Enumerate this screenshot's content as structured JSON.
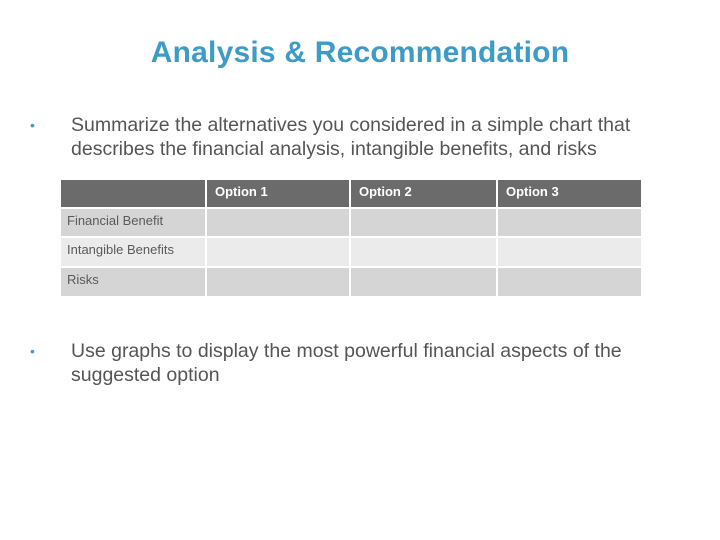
{
  "title": "Analysis & Recommendation",
  "bullets": [
    {
      "icon": "bullet-dot",
      "symbol": "•",
      "text": "Summarize the alternatives you considered in a simple chart that describes the financial analysis, intangible benefits, and risks"
    },
    {
      "icon": "bullet-dot",
      "symbol": "•",
      "text": "Use graphs to display the most powerful financial aspects of the suggested option"
    }
  ],
  "table": {
    "columns": [
      "",
      "Option 1",
      "Option 2",
      "Option 3"
    ],
    "rows": [
      {
        "label": "Financial Benefit",
        "cells": [
          "",
          "",
          ""
        ]
      },
      {
        "label": "Intangible Benefits",
        "cells": [
          "",
          "",
          ""
        ]
      },
      {
        "label": "Risks",
        "cells": [
          "",
          "",
          ""
        ]
      }
    ]
  },
  "colors": {
    "title": "#3d9cc6",
    "bullet": "#4a9cc2",
    "header_bg": "#6b6b6b",
    "row_dark": "#d5d5d5",
    "row_light": "#ebebeb"
  }
}
